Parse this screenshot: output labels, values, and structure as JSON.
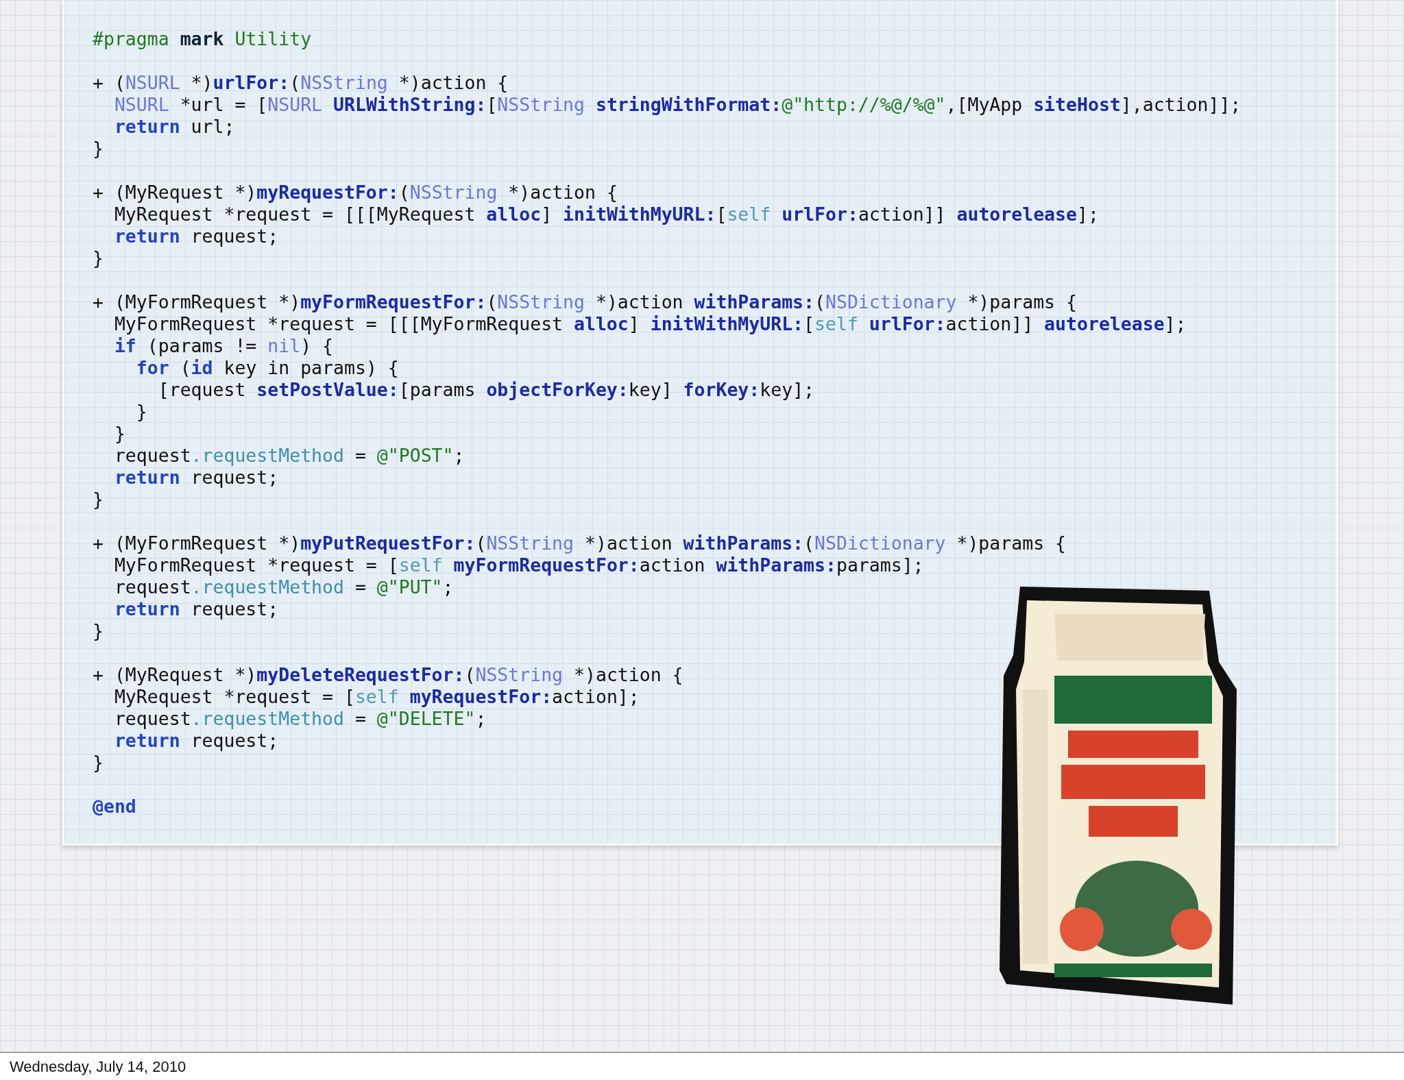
{
  "code_blocks": [
    {
      "lines": [
        {
          "tokens": [
            {
              "kind": "directive",
              "text": "#pragma"
            },
            {
              "kind": "directive-keyword",
              "text": "mark",
              "space_before": true
            },
            {
              "kind": "directive",
              "text": "Utility",
              "space_before": true
            }
          ]
        }
      ]
    },
    {
      "lines": [
        {
          "tokens": [
            {
              "kind": "plain",
              "text": "+ ("
            },
            {
              "kind": "type",
              "text": "NSURL"
            },
            {
              "kind": "plain",
              "text": " *)"
            },
            {
              "kind": "method",
              "text": "urlFor:"
            },
            {
              "kind": "plain",
              "text": "("
            },
            {
              "kind": "type",
              "text": "NSString"
            },
            {
              "kind": "plain",
              "text": " *)action {"
            }
          ],
          "children": [
            {
              "tokens": [
                {
                  "kind": "type",
                  "text": "NSURL"
                },
                {
                  "kind": "plain",
                  "text": " *url = ["
                },
                {
                  "kind": "type",
                  "text": "NSURL"
                },
                {
                  "kind": "method",
                  "text": "URLWithString:",
                  "space_before": true
                },
                {
                  "kind": "plain",
                  "text": "["
                },
                {
                  "kind": "type",
                  "text": "NSString"
                },
                {
                  "kind": "method",
                  "text": "stringWithFormat:",
                  "space_before": true
                },
                {
                  "kind": "string",
                  "text": "@\"http://%@/%@\""
                },
                {
                  "kind": "plain",
                  "text": ",[MyApp "
                },
                {
                  "kind": "method",
                  "text": "siteHost"
                },
                {
                  "kind": "plain",
                  "text": "],action]];"
                }
              ]
            },
            {
              "tokens": [
                {
                  "kind": "keyword",
                  "text": "return"
                },
                {
                  "kind": "plain",
                  "text": " url;"
                }
              ]
            }
          ]
        },
        {
          "tokens": [
            {
              "kind": "plain",
              "text": "}"
            }
          ]
        }
      ]
    },
    {
      "lines": [
        {
          "tokens": [
            {
              "kind": "plain",
              "text": "+ (MyRequest *)"
            },
            {
              "kind": "method",
              "text": "myRequestFor:"
            },
            {
              "kind": "plain",
              "text": "("
            },
            {
              "kind": "type",
              "text": "NSString"
            },
            {
              "kind": "plain",
              "text": " *)action {"
            }
          ],
          "children": [
            {
              "tokens": [
                {
                  "kind": "plain",
                  "text": "MyRequest *request = [[[MyRequest "
                },
                {
                  "kind": "method",
                  "text": "alloc"
                },
                {
                  "kind": "plain",
                  "text": "] "
                },
                {
                  "kind": "method",
                  "text": "initWithMyURL:"
                },
                {
                  "kind": "plain",
                  "text": "["
                },
                {
                  "kind": "self",
                  "text": "self"
                },
                {
                  "kind": "method",
                  "text": "urlFor:",
                  "space_before": true
                },
                {
                  "kind": "plain",
                  "text": "action]] "
                },
                {
                  "kind": "method",
                  "text": "autorelease"
                },
                {
                  "kind": "plain",
                  "text": "];"
                }
              ]
            },
            {
              "tokens": [
                {
                  "kind": "keyword",
                  "text": "return"
                },
                {
                  "kind": "plain",
                  "text": " request;"
                }
              ]
            }
          ]
        },
        {
          "tokens": [
            {
              "kind": "plain",
              "text": "}"
            }
          ]
        }
      ]
    },
    {
      "lines": [
        {
          "tokens": [
            {
              "kind": "plain",
              "text": "+ (MyFormRequest *)"
            },
            {
              "kind": "method",
              "text": "myFormRequestFor:"
            },
            {
              "kind": "plain",
              "text": "("
            },
            {
              "kind": "type",
              "text": "NSString"
            },
            {
              "kind": "plain",
              "text": " *)action "
            },
            {
              "kind": "method",
              "text": "withParams:"
            },
            {
              "kind": "plain",
              "text": "("
            },
            {
              "kind": "type",
              "text": "NSDictionary"
            },
            {
              "kind": "plain",
              "text": " *)params {"
            }
          ],
          "children": [
            {
              "tokens": [
                {
                  "kind": "plain",
                  "text": "MyFormRequest *request = [[[MyFormRequest "
                },
                {
                  "kind": "method",
                  "text": "alloc"
                },
                {
                  "kind": "plain",
                  "text": "] "
                },
                {
                  "kind": "method",
                  "text": "initWithMyURL:"
                },
                {
                  "kind": "plain",
                  "text": "["
                },
                {
                  "kind": "self",
                  "text": "self"
                },
                {
                  "kind": "method",
                  "text": "urlFor:",
                  "space_before": true
                },
                {
                  "kind": "plain",
                  "text": "action]] "
                },
                {
                  "kind": "method",
                  "text": "autorelease"
                },
                {
                  "kind": "plain",
                  "text": "];"
                }
              ]
            },
            {
              "tokens": [
                {
                  "kind": "keyword",
                  "text": "if"
                },
                {
                  "kind": "plain",
                  "text": " (params != "
                },
                {
                  "kind": "type",
                  "text": "nil"
                },
                {
                  "kind": "plain",
                  "text": ") {"
                }
              ],
              "children": [
                {
                  "tokens": [
                    {
                      "kind": "keyword",
                      "text": "for"
                    },
                    {
                      "kind": "plain",
                      "text": " ("
                    },
                    {
                      "kind": "keyword",
                      "text": "id"
                    },
                    {
                      "kind": "plain",
                      "text": " key in params) {"
                    }
                  ],
                  "children": [
                    {
                      "tokens": [
                        {
                          "kind": "plain",
                          "text": "[request "
                        },
                        {
                          "kind": "method",
                          "text": "setPostValue:"
                        },
                        {
                          "kind": "plain",
                          "text": "[params "
                        },
                        {
                          "kind": "method",
                          "text": "objectForKey:"
                        },
                        {
                          "kind": "plain",
                          "text": "key] "
                        },
                        {
                          "kind": "method",
                          "text": "forKey:"
                        },
                        {
                          "kind": "plain",
                          "text": "key];"
                        }
                      ]
                    }
                  ]
                },
                {
                  "tokens": [
                    {
                      "kind": "plain",
                      "text": "}"
                    }
                  ]
                }
              ]
            },
            {
              "tokens": [
                {
                  "kind": "plain",
                  "text": "}"
                }
              ]
            },
            {
              "tokens": [
                {
                  "kind": "plain",
                  "text": "request"
                },
                {
                  "kind": "property",
                  "text": ".requestMethod"
                },
                {
                  "kind": "plain",
                  "text": " = "
                },
                {
                  "kind": "string",
                  "text": "@\"POST\""
                },
                {
                  "kind": "plain",
                  "text": ";"
                }
              ]
            },
            {
              "tokens": [
                {
                  "kind": "keyword",
                  "text": "return"
                },
                {
                  "kind": "plain",
                  "text": " request;"
                }
              ]
            }
          ]
        },
        {
          "tokens": [
            {
              "kind": "plain",
              "text": "}"
            }
          ]
        }
      ]
    },
    {
      "lines": [
        {
          "tokens": [
            {
              "kind": "plain",
              "text": "+ (MyFormRequest *)"
            },
            {
              "kind": "method",
              "text": "myPutRequestFor:"
            },
            {
              "kind": "plain",
              "text": "("
            },
            {
              "kind": "type",
              "text": "NSString"
            },
            {
              "kind": "plain",
              "text": " *)action "
            },
            {
              "kind": "method",
              "text": "withParams:"
            },
            {
              "kind": "plain",
              "text": "("
            },
            {
              "kind": "type",
              "text": "NSDictionary"
            },
            {
              "kind": "plain",
              "text": " *)params {"
            }
          ],
          "children": [
            {
              "tokens": [
                {
                  "kind": "plain",
                  "text": "MyFormRequest *request = ["
                },
                {
                  "kind": "self",
                  "text": "self"
                },
                {
                  "kind": "method",
                  "text": "myFormRequestFor:",
                  "space_before": true
                },
                {
                  "kind": "plain",
                  "text": "action "
                },
                {
                  "kind": "method",
                  "text": "withParams:"
                },
                {
                  "kind": "plain",
                  "text": "params];"
                }
              ]
            },
            {
              "tokens": [
                {
                  "kind": "plain",
                  "text": "request"
                },
                {
                  "kind": "property",
                  "text": ".requestMethod"
                },
                {
                  "kind": "plain",
                  "text": " = "
                },
                {
                  "kind": "string",
                  "text": "@\"PUT\""
                },
                {
                  "kind": "plain",
                  "text": ";"
                }
              ]
            },
            {
              "tokens": [
                {
                  "kind": "keyword",
                  "text": "return"
                },
                {
                  "kind": "plain",
                  "text": " request;"
                }
              ]
            }
          ]
        },
        {
          "tokens": [
            {
              "kind": "plain",
              "text": "}"
            }
          ]
        }
      ]
    },
    {
      "lines": [
        {
          "tokens": [
            {
              "kind": "plain",
              "text": "+ (MyRequest *)"
            },
            {
              "kind": "method",
              "text": "myDeleteRequestFor:"
            },
            {
              "kind": "plain",
              "text": "("
            },
            {
              "kind": "type",
              "text": "NSString"
            },
            {
              "kind": "plain",
              "text": " *)action {"
            }
          ],
          "children": [
            {
              "tokens": [
                {
                  "kind": "plain",
                  "text": "MyRequest *request = ["
                },
                {
                  "kind": "self",
                  "text": "self"
                },
                {
                  "kind": "method",
                  "text": "myRequestFor:",
                  "space_before": true
                },
                {
                  "kind": "plain",
                  "text": "action];"
                }
              ]
            },
            {
              "tokens": [
                {
                  "kind": "plain",
                  "text": "request"
                },
                {
                  "kind": "property",
                  "text": ".requestMethod"
                },
                {
                  "kind": "plain",
                  "text": " = "
                },
                {
                  "kind": "string",
                  "text": "@\"DELETE\""
                },
                {
                  "kind": "plain",
                  "text": ";"
                }
              ]
            },
            {
              "tokens": [
                {
                  "kind": "keyword",
                  "text": "return"
                },
                {
                  "kind": "plain",
                  "text": " request;"
                }
              ]
            }
          ]
        },
        {
          "tokens": [
            {
              "kind": "plain",
              "text": "}"
            }
          ]
        }
      ]
    },
    {
      "lines": [
        {
          "tokens": [
            {
              "kind": "keyword",
              "text": "@end"
            }
          ]
        }
      ]
    }
  ],
  "footer": {
    "date": "Wednesday, July 14, 2010"
  }
}
